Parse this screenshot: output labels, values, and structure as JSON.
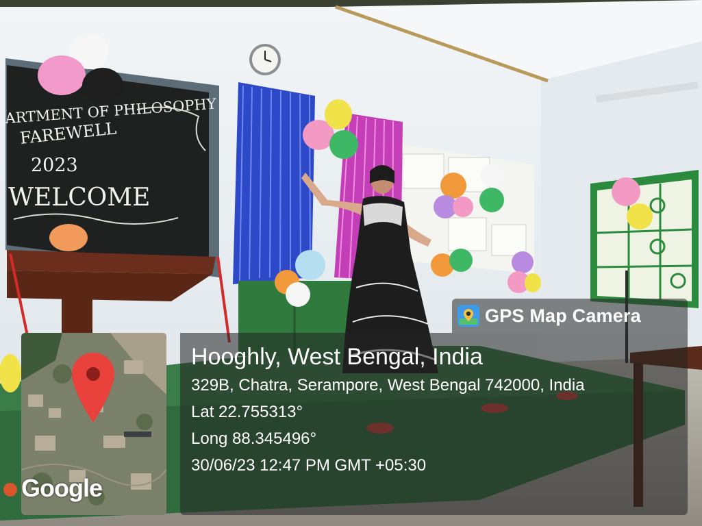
{
  "scene": {
    "description_tag": "classroom-farewell-stage-photo",
    "blackboard": {
      "line1": "ARTMENT OF PHILOSOPHY",
      "line2": "FAREWELL",
      "line3": "2023",
      "line4": "WELCOME"
    },
    "colors": {
      "wall": "#e9eef2",
      "blackboard": "#1f2120",
      "stage": "#2f6b3c",
      "blue_curtain": "#2d49c8",
      "pink_curtain": "#c43fb7"
    }
  },
  "watermark": {
    "app_name": "GPS Map Camera",
    "app_icon": "gps-map-camera-app-icon",
    "map_logo": "Google",
    "place": "Hooghly, West Bengal, India",
    "address": "329B, Chatra, Serampore, West Bengal 742000, India",
    "lat": "Lat 22.755313°",
    "long": "Long 88.345496°",
    "datetime": "30/06/23 12:47 PM GMT +05:30"
  }
}
